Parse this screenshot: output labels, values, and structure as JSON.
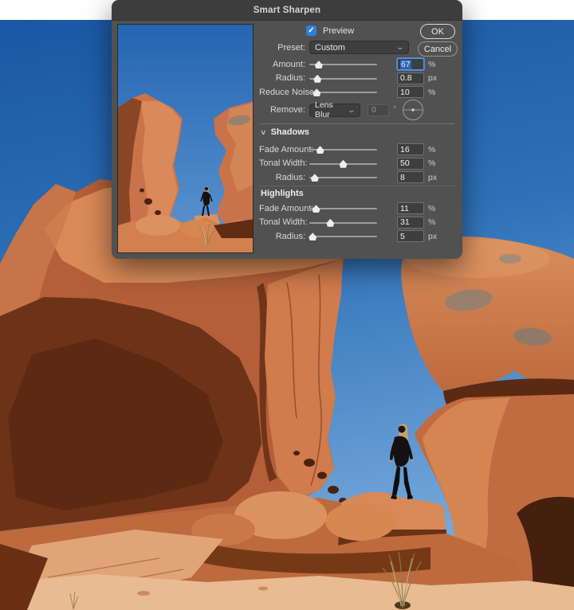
{
  "dialog": {
    "title": "Smart Sharpen",
    "preview": {
      "label": "Preview",
      "checked": true
    },
    "preset": {
      "label": "Preset:",
      "value": "Custom"
    },
    "buttons": {
      "ok": "OK",
      "cancel": "Cancel"
    },
    "sliders_main": [
      {
        "label": "Amount:",
        "value": "67",
        "unit": "%",
        "pct": 14,
        "focused": true
      },
      {
        "label": "Radius:",
        "value": "0.8",
        "unit": "px",
        "pct": 12,
        "focused": false
      },
      {
        "label": "Reduce Noise:",
        "value": "10",
        "unit": "%",
        "pct": 11,
        "focused": false
      }
    ],
    "remove": {
      "label": "Remove:",
      "value": "Lens Blur",
      "angle_value": "0",
      "angle_unit": "°"
    },
    "shadows": {
      "header": "Shadows",
      "rows": [
        {
          "label": "Fade Amount:",
          "value": "16",
          "unit": "%",
          "pct": 16,
          "focused": false
        },
        {
          "label": "Tonal Width:",
          "value": "50",
          "unit": "%",
          "pct": 50,
          "focused": false
        },
        {
          "label": "Radius:",
          "value": "8",
          "unit": "px",
          "pct": 8,
          "focused": false
        }
      ]
    },
    "highlights": {
      "header": "Highlights",
      "rows": [
        {
          "label": "Fade Amount:",
          "value": "11",
          "unit": "%",
          "pct": 10,
          "focused": false
        },
        {
          "label": "Tonal Width:",
          "value": "31",
          "unit": "%",
          "pct": 31,
          "focused": false
        },
        {
          "label": "Radius:",
          "value": "5",
          "unit": "px",
          "pct": 5,
          "focused": false
        }
      ]
    }
  },
  "icons": {
    "checkbox_check": "✓",
    "dropdown_chevron": "⌄",
    "section_chevron": "∨"
  },
  "colors": {
    "accent_blue": "#2f7fdd",
    "selection_blue": "#2d63b8",
    "dialog_bg": "#515151",
    "titlebar_bg": "#3d3d3d",
    "field_bg": "#3e3e3e",
    "sky_top": "#1a57a4",
    "sky_bottom": "#79abdc",
    "rock_bright": "#d98a5a",
    "rock_shadow": "#6d3318"
  }
}
